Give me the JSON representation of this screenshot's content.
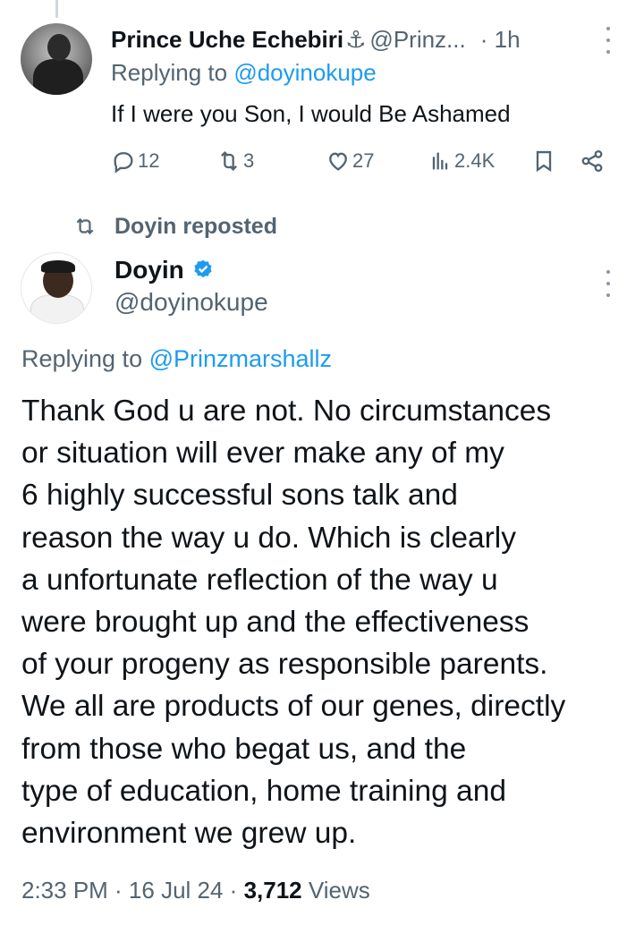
{
  "reply_tweet": {
    "display_name": "Prince Uche Echebiri",
    "name_emoji": "⚓",
    "handle": "@Prinz...",
    "time": "· 1h",
    "replying_prefix": "Replying to ",
    "replying_to": "@doyinokupe",
    "text": "If I were you Son, I would Be Ashamed",
    "actions": {
      "replies": "12",
      "reposts": "3",
      "likes": "27",
      "views": "2.4K"
    }
  },
  "repost_label": "Doyin reposted",
  "main_tweet": {
    "display_name": "Doyin",
    "handle": "@doyinokupe",
    "replying_prefix": "Replying to ",
    "replying_to": "@Prinzmarshallz",
    "lines": [
      "Thank God u are not. No circumstances",
      "or situation will ever make any of my",
      "6 highly successful sons talk and",
      "reason the way u do. Which is clearly",
      "a unfortunate reflection of the way u",
      "were brought up and the effectiveness",
      "of your progeny as responsible parents.",
      "We all are products of our genes, directly",
      "from those who begat us, and the",
      "type of education, home training and",
      "environment we grew up."
    ],
    "timestamp": "2:33 PM · 16 Jul 24 · ",
    "views_count": "3,712",
    "views_label": " Views"
  },
  "colors": {
    "accent": "#1d9bf0",
    "secondary_text": "#536471",
    "primary_text": "#0f1419"
  },
  "icons": {
    "reply": "speech-bubble-icon",
    "repost": "repost-arrows-icon",
    "like": "heart-icon",
    "views": "bar-chart-icon",
    "bookmark": "bookmark-icon",
    "share": "share-nodes-icon",
    "more": "vertical-dots-icon",
    "verified": "verified-badge-icon"
  }
}
